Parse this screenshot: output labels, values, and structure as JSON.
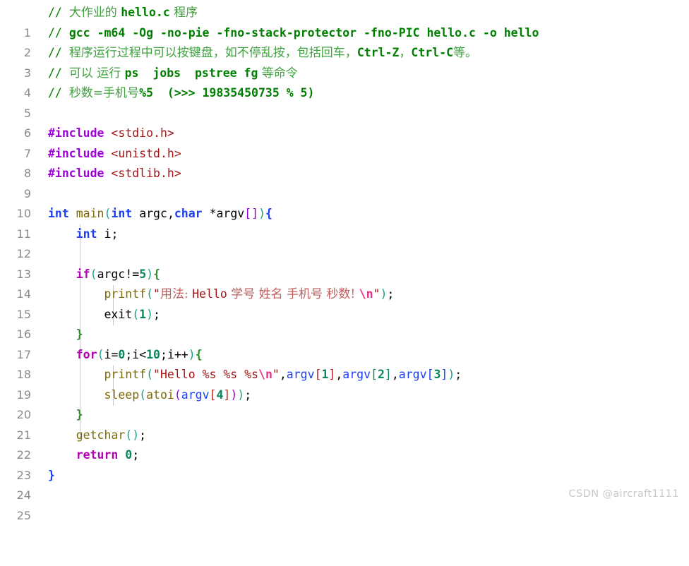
{
  "editor": {
    "language": "c",
    "background_color": "#ffffff",
    "line_number_color": "#8a8a8a",
    "indent_guide_color": "#c8c8c8",
    "first_line": 1,
    "last_line": 25,
    "line_numbers": [
      "1",
      "2",
      "3",
      "4",
      "5",
      "6",
      "7",
      "8",
      "9",
      "10",
      "11",
      "12",
      "13",
      "14",
      "15",
      "16",
      "17",
      "18",
      "19",
      "20",
      "21",
      "22",
      "23",
      "24",
      "25"
    ],
    "lines": [
      {
        "n": "1",
        "text": "// 大作业的 hello.c 程序"
      },
      {
        "n": "2",
        "text": "// gcc -m64 -Og -no-pie -fno-stack-protector -fno-PIC hello.c -o hello"
      },
      {
        "n": "3",
        "text": "// 程序运行过程中可以按键盘，如不停乱按，包括回车，Ctrl-Z，Ctrl-C等。"
      },
      {
        "n": "4",
        "text": "// 可以 运行 ps  jobs  pstree fg 等命令"
      },
      {
        "n": "5",
        "text": "// 秒数=手机号%5  (>>> 19835450735 % 5)"
      },
      {
        "n": "6",
        "text": ""
      },
      {
        "n": "7",
        "text": "#include <stdio.h>"
      },
      {
        "n": "8",
        "text": "#include <unistd.h>"
      },
      {
        "n": "9",
        "text": "#include <stdlib.h>"
      },
      {
        "n": "10",
        "text": ""
      },
      {
        "n": "11",
        "text": "int main(int argc,char *argv[]){"
      },
      {
        "n": "12",
        "text": "    int i;"
      },
      {
        "n": "13",
        "text": ""
      },
      {
        "n": "14",
        "text": "    if(argc!=5){"
      },
      {
        "n": "15",
        "text": "        printf(\"用法: Hello 学号 姓名 手机号 秒数! \\n\");"
      },
      {
        "n": "16",
        "text": "        exit(1);"
      },
      {
        "n": "17",
        "text": "    }"
      },
      {
        "n": "18",
        "text": "    for(i=0;i<10;i++){"
      },
      {
        "n": "19",
        "text": "        printf(\"Hello %s %s %s\\n\",argv[1],argv[2],argv[3]);"
      },
      {
        "n": "20",
        "text": "        sleep(atoi(argv[4]));"
      },
      {
        "n": "21",
        "text": "    }"
      },
      {
        "n": "22",
        "text": "    getchar();"
      },
      {
        "n": "23",
        "text": "    return 0;"
      },
      {
        "n": "24",
        "text": "}"
      },
      {
        "n": "25",
        "text": ""
      }
    ],
    "tokens": {
      "l1": {
        "comment_slashes": "// ",
        "cjk_a": "大作业的 ",
        "code": "hello.c",
        "cjk_b": " 程序"
      },
      "l2": {
        "comment_slashes": "// ",
        "command": "gcc -m64 -Og -no-pie -fno-stack-protector -fno-PIC hello.c -o hello"
      },
      "l3": {
        "comment_slashes": "// ",
        "cjk_a": "程序运行过程中可以按键盘，如不停乱按，包括回车，",
        "code_a": "Ctrl-Z",
        "cjk_b": "，",
        "code_b": "Ctrl-C",
        "cjk_c": "等。"
      },
      "l4": {
        "comment_slashes": "// ",
        "cjk_a": "可以 运行 ",
        "code_a": "ps",
        "gap_a": "  ",
        "code_b": "jobs",
        "gap_b": "  ",
        "code_c": "pstree fg",
        "cjk_b": " 等命令"
      },
      "l5": {
        "comment_slashes": "// ",
        "cjk_a": "秒数=手机号",
        "code_a": "%5",
        "gap": "  ",
        "code_b": "(>>> 19835450735 % 5)"
      },
      "l7": {
        "directive": "#include",
        "space": " ",
        "header": "<stdio.h>"
      },
      "l8": {
        "directive": "#include",
        "space": " ",
        "header": "<unistd.h>"
      },
      "l9": {
        "directive": "#include",
        "space": " ",
        "header": "<stdlib.h>"
      },
      "l11": {
        "kw_int": "int",
        "sp1": " ",
        "fn_main": "main",
        "p_open": "(",
        "kw_int2": "int",
        "sp2": " ",
        "id_argc": "argc",
        "comma": ",",
        "kw_char": "char",
        "sp3": " ",
        "star_argv": "*argv",
        "br_open": "[",
        "br_close": "]",
        "p_close": ")",
        "brace_open": "{"
      },
      "l12": {
        "indent": "    ",
        "kw_int": "int",
        "sp": " ",
        "id_i": "i",
        "semi": ";"
      },
      "l14": {
        "indent": "    ",
        "kw_if": "if",
        "p_open": "(",
        "id_argc": "argc",
        "op": "!=",
        "num5": "5",
        "p_close": ")",
        "brace_open": "{"
      },
      "l15": {
        "indent": "        ",
        "fn_printf": "printf",
        "p_open": "(",
        "quote_open": "\"",
        "str_cjk_a": "用法: ",
        "str_hello": "Hello",
        "str_cjk_b": " 学号 姓名 手机号 秒数! ",
        "esc": "\\n",
        "quote_close": "\"",
        "p_close": ")",
        "semi": ";"
      },
      "l16": {
        "indent": "        ",
        "fn_exit": "exit",
        "p_open": "(",
        "num1": "1",
        "p_close": ")",
        "semi": ";"
      },
      "l17": {
        "indent": "    ",
        "brace_close": "}"
      },
      "l18": {
        "indent": "    ",
        "kw_for": "for",
        "p_open": "(",
        "id_i": "i",
        "eq": "=",
        "num0": "0",
        "semi1": ";",
        "id_i2": "i",
        "lt": "<",
        "num10": "10",
        "semi2": ";",
        "id_i3": "i",
        "inc": "++",
        "p_close": ")",
        "brace_open": "{"
      },
      "l19": {
        "indent": "        ",
        "fn_printf": "printf",
        "p_open": "(",
        "quote_open": "\"",
        "str_body": "Hello %s %s %s",
        "esc": "\\n",
        "quote_close": "\"",
        "comma1": ",",
        "var1": "argv",
        "b1o": "[",
        "n1": "1",
        "b1c": "]",
        "comma2": ",",
        "var2": "argv",
        "b2o": "[",
        "n2": "2",
        "b2c": "]",
        "comma3": ",",
        "var3": "argv",
        "b3o": "[",
        "n3": "3",
        "b3c": "]",
        "p_close": ")",
        "semi": ";"
      },
      "l20": {
        "indent": "        ",
        "fn_sleep": "sleep",
        "p_open": "(",
        "fn_atoi": "atoi",
        "p_open2": "(",
        "var_argv": "argv",
        "b_open": "[",
        "num4": "4",
        "b_close": "]",
        "p_close2": ")",
        "p_close": ")",
        "semi": ";"
      },
      "l21": {
        "indent": "    ",
        "brace_close": "}"
      },
      "l22": {
        "indent": "    ",
        "fn_getchar": "getchar",
        "p_open": "(",
        "p_close": ")",
        "semi": ";"
      },
      "l23": {
        "indent": "    ",
        "kw_return": "return",
        "sp": " ",
        "num0": "0",
        "semi": ";"
      },
      "l24": {
        "brace_close": "}"
      }
    }
  },
  "watermark": {
    "text": "CSDN @aircraft1111",
    "color": "#c9c9c9"
  }
}
